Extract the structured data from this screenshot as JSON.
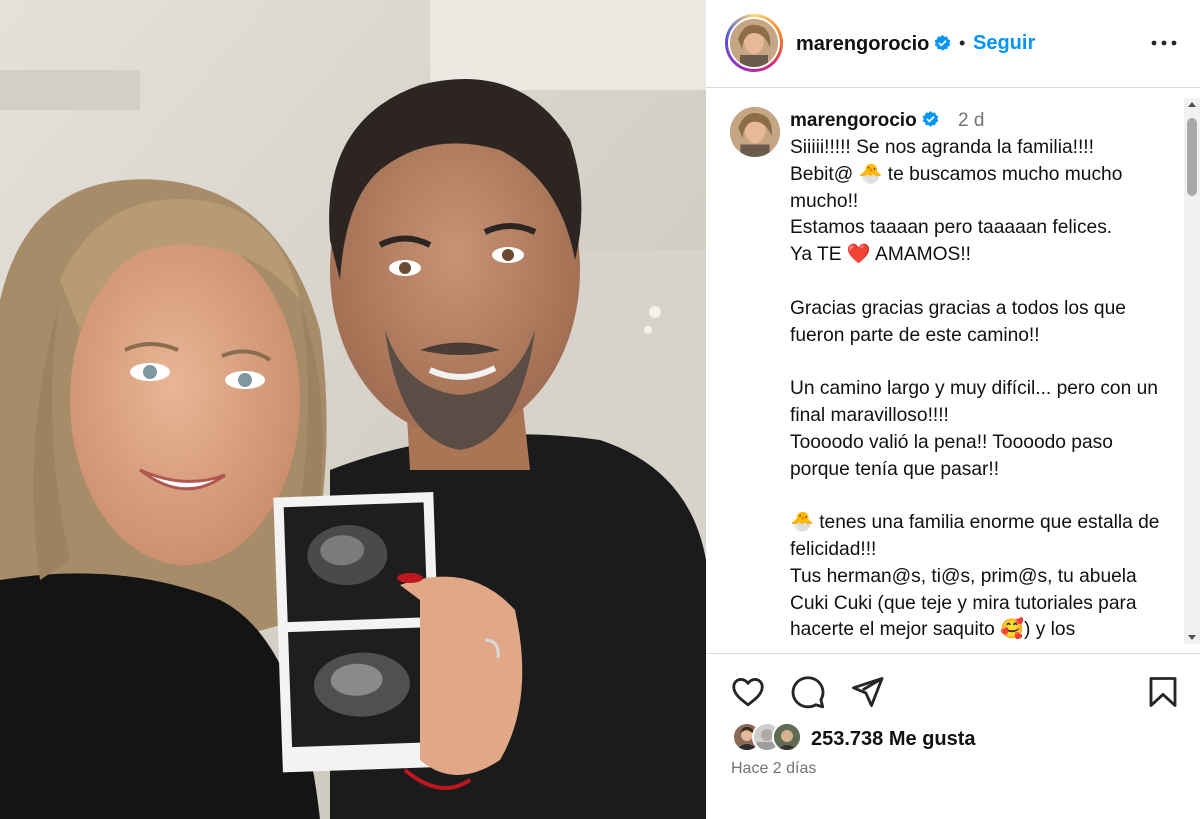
{
  "post": {
    "username": "marengorocio",
    "follow_label": "Seguir",
    "separator": "•",
    "comment_time": "2 d",
    "caption": "Siiiii!!!!! Se nos agranda la familia!!!!\nBebit@ 🐣 te buscamos mucho mucho mucho!!\nEstamos taaaan pero taaaaan felices.\nYa TE ❤️ AMAMOS!!\n\nGracias gracias gracias a todos los que fueron parte de este camino!!\n\nUn camino largo y muy difícil... pero con un final maravilloso!!!!\nToooodo valió la pena!! Toooodo paso porque tenía que pasar!!\n\n🐣 tenes una familia enorme que estalla de felicidad!!!\nTus herman@s, ti@s, prim@s, tu abuela Cuki Cuki (que teje y mira tutoriales para hacerte el mejor saquito 🥰) y los",
    "likes": "253.738 Me gusta",
    "posted": "Hace 2 días"
  },
  "icons": {
    "more": "more-options-icon",
    "verified": "verified-badge-icon",
    "like": "heart-icon",
    "comment": "comment-icon",
    "share": "send-icon",
    "save": "bookmark-icon"
  },
  "colors": {
    "link": "#0095f6",
    "verified": "#0095f6",
    "muted": "#737373",
    "border": "#dbdbdb"
  }
}
